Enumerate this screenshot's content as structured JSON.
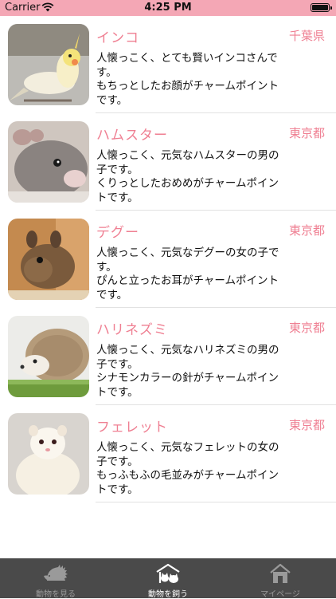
{
  "status": {
    "carrier": "Carrier",
    "time": "4:25 PM"
  },
  "animals": [
    {
      "name": "インコ",
      "prefecture": "千葉県",
      "lines": [
        "人懐っこく、とても賢いインコさんで",
        "す。",
        "もちっとしたお顔がチャームポイント",
        "です。"
      ]
    },
    {
      "name": "ハムスター",
      "prefecture": "東京都",
      "lines": [
        "人懐っこく、元気なハムスターの男の",
        "子です。",
        "くりっとしたおめめがチャームポイン",
        "トです。"
      ]
    },
    {
      "name": "デグー",
      "prefecture": "東京都",
      "lines": [
        "人懐っこく、元気なデグーの女の子で",
        "す。",
        "ぴんと立ったお耳がチャームポイント",
        "です。"
      ]
    },
    {
      "name": "ハリネズミ",
      "prefecture": "東京都",
      "lines": [
        "人懐っこく、元気なハリネズミの男の",
        "子です。",
        "シナモンカラーの針がチャームポイン",
        "トです。"
      ]
    },
    {
      "name": "フェレット",
      "prefecture": "東京都",
      "lines": [
        "人懐っこく、元気なフェレットの女の",
        "子です。",
        "もっふもふの毛並みがチャームポイン",
        "トです。"
      ]
    }
  ],
  "tabs": [
    {
      "label": "動物を見る",
      "icon": "hedgehog-icon",
      "active": false
    },
    {
      "label": "動物を飼う",
      "icon": "house-animals-icon",
      "active": true
    },
    {
      "label": "マイページ",
      "icon": "home-icon",
      "active": false
    }
  ],
  "colors": {
    "status_bar": "#f4a7b5",
    "accent": "#ef7f92",
    "tabbar": "#4a4a4a"
  }
}
